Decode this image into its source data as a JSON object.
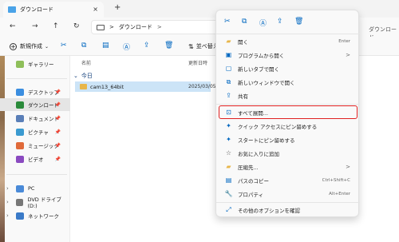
{
  "tab": {
    "title": "ダウンロード",
    "close": "×",
    "new": "+"
  },
  "nav": {
    "back": "←",
    "forward": "→",
    "up": "↑",
    "refresh": "↻",
    "path": "ダウンロード",
    "sep": ">",
    "right_addr": "ダウンロード"
  },
  "toolbar": {
    "new_label": "新規作成",
    "sort_label": "並べ替え"
  },
  "sidebar": {
    "items": [
      {
        "label": "ギャラリー"
      },
      {
        "label": "デスクトップ"
      },
      {
        "label": "ダウンロード"
      },
      {
        "label": "ドキュメント"
      },
      {
        "label": "ピクチャ"
      },
      {
        "label": "ミュージック"
      },
      {
        "label": "ビデオ"
      },
      {
        "label": "PC"
      },
      {
        "label": "DVD ドライブ (D:)"
      },
      {
        "label": "ネットワーク"
      }
    ]
  },
  "main": {
    "col_name": "名前",
    "col_date": "更新日時",
    "group": "今日",
    "file": {
      "name": "cam13_64bit",
      "date": "2025/03/05"
    }
  },
  "menu": {
    "items": [
      {
        "label": "開く",
        "shortcut": "Enter"
      },
      {
        "label": "プログラムから開く",
        "arrow": ">"
      },
      {
        "label": "新しいタブで開く"
      },
      {
        "label": "新しいウィンドウで開く"
      },
      {
        "label": "共有"
      },
      {
        "label": "すべて展開..."
      },
      {
        "label": "クイック アクセスにピン留めする"
      },
      {
        "label": "スタートにピン留めする"
      },
      {
        "label": "お気に入りに追加"
      },
      {
        "label": "圧縮先...",
        "arrow": ">"
      },
      {
        "label": "パスのコピー",
        "shortcut": "Ctrl+Shift+C"
      },
      {
        "label": "プロパティ",
        "shortcut": "Alt+Enter"
      },
      {
        "label": "その他のオプションを確認"
      }
    ]
  },
  "colors": {
    "accent": "#0067c0",
    "selection": "#cce4f7",
    "highlight_box": "#e02020"
  }
}
